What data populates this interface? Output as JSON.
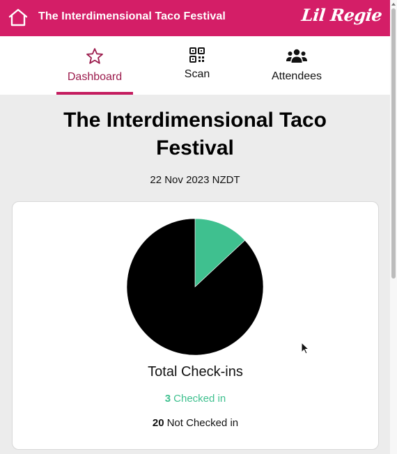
{
  "header": {
    "title": "The Interdimensional Taco Festival",
    "brand": "Lil Regie",
    "home_icon": "home-icon",
    "background_color": "#d41e67"
  },
  "nav": {
    "tabs": [
      {
        "label": "Dashboard",
        "icon": "star-icon",
        "active": true
      },
      {
        "label": "Scan",
        "icon": "qr-code-icon",
        "active": false
      },
      {
        "label": "Attendees",
        "icon": "people-icon",
        "active": false
      }
    ],
    "active_color": "#c41c5f"
  },
  "event": {
    "title": "The Interdimensional Taco Festival",
    "date": "22 Nov 2023 NZDT"
  },
  "chart_data": {
    "type": "pie",
    "title": "Total Check-ins",
    "slices": [
      {
        "label": "Checked in",
        "value": 3,
        "color": "#3fc08f"
      },
      {
        "label": "Not Checked in",
        "value": 20,
        "color": "#000000"
      }
    ]
  },
  "legend": {
    "checked_count": "3",
    "checked_label": "Checked in",
    "not_checked_count": "20",
    "not_checked_label": "Not Checked in"
  }
}
